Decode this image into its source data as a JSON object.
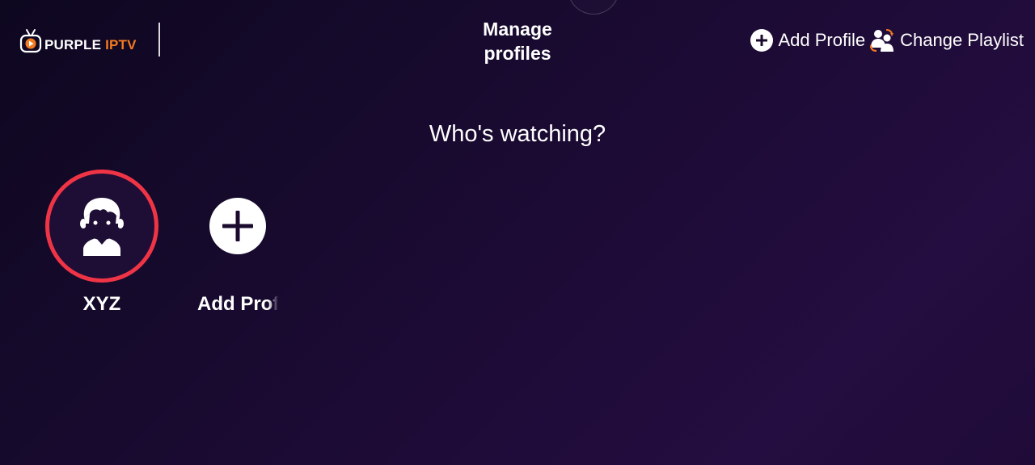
{
  "brand": {
    "name_part1": "PURPLE ",
    "name_part2": "IPTV",
    "accent_color": "#f47a1f",
    "icon": "tv-icon"
  },
  "header": {
    "title": "Manage\nprofiles",
    "actions": [
      {
        "label": "Add Profile",
        "icon": "add-circle-icon"
      },
      {
        "label": "Change Playlist",
        "icon": "switch-users-icon"
      }
    ]
  },
  "main": {
    "heading": "Who's watching?",
    "profiles": [
      {
        "name": "XYZ",
        "icon": "user-avatar-icon",
        "selected": true,
        "highlight_color": "#ef3446"
      },
      {
        "name": "Add Profile",
        "icon": "add-circle-icon"
      }
    ]
  }
}
